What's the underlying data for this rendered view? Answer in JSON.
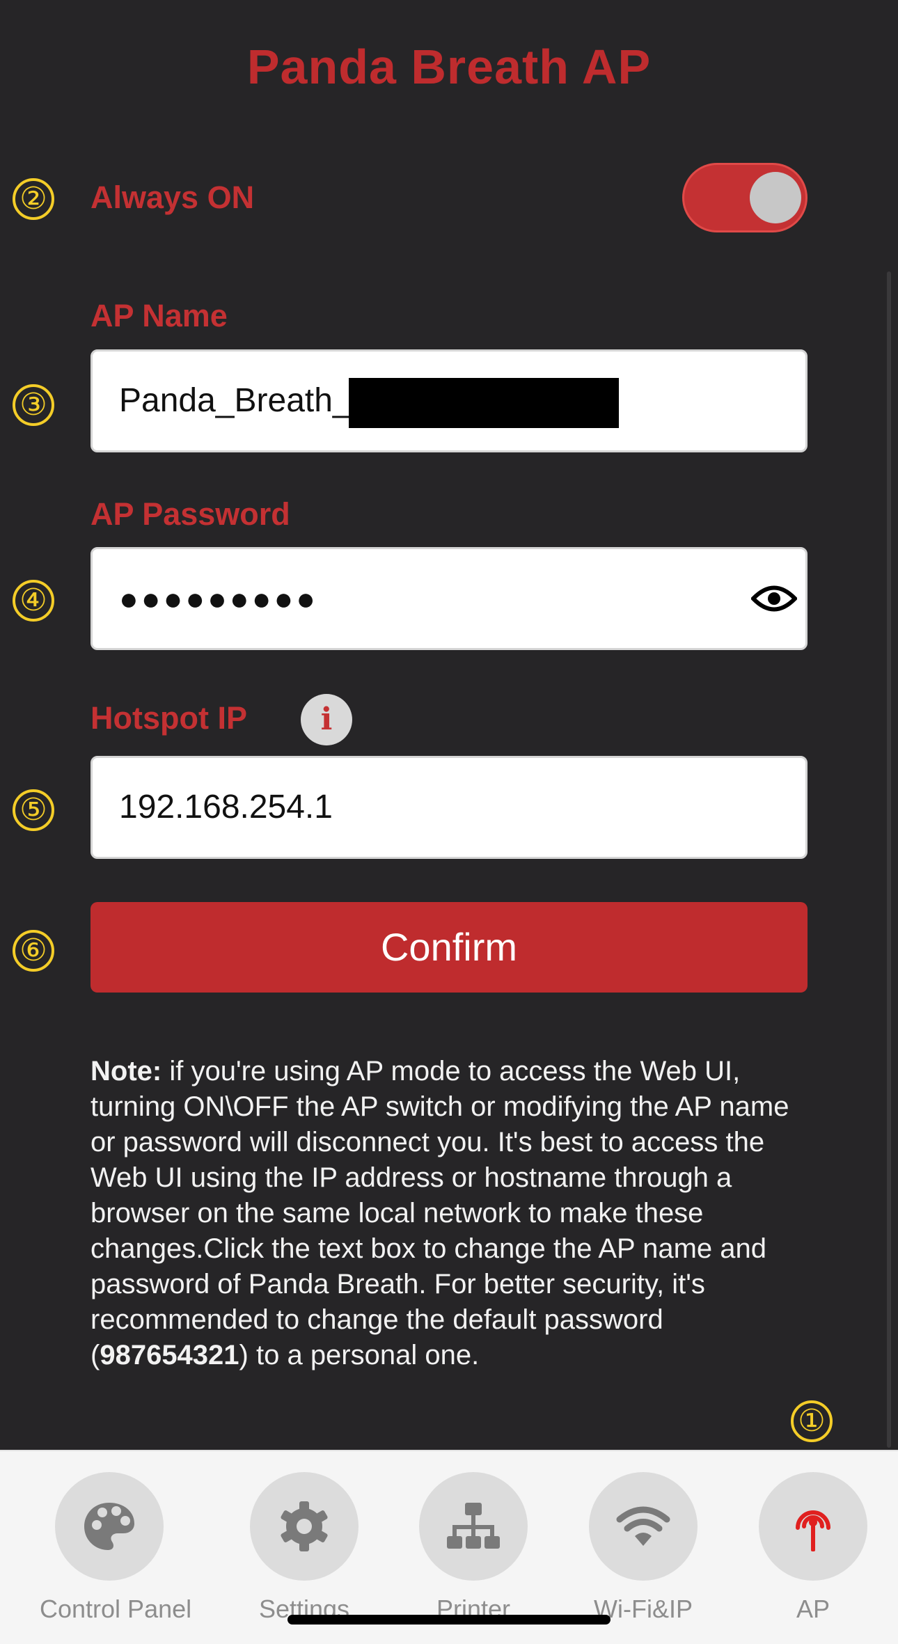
{
  "header": {
    "title": "Panda Breath AP"
  },
  "annotations": {
    "a1": "①",
    "a2": "②",
    "a3": "③",
    "a4": "④",
    "a5": "⑤",
    "a6": "⑥"
  },
  "always_on": {
    "label": "Always ON",
    "enabled": true
  },
  "ap_name": {
    "label": "AP Name",
    "value": "Panda_Breath_"
  },
  "ap_password": {
    "label": "AP Password",
    "value": "●●●●●●●●●"
  },
  "hotspot_ip": {
    "label": "Hotspot IP",
    "info": "i",
    "value": "192.168.254.1"
  },
  "confirm": {
    "label": "Confirm"
  },
  "note": {
    "prefix": "Note:",
    "text1": " if you're using AP mode to access the Web UI, turning ON\\OFF the AP switch or modifying the AP name or password will disconnect you. It's best to access the Web UI using the IP address or hostname through a browser on the same local network to make these changes.Click the text box to change the AP name and password of Panda Breath. For better security, it's recommended to change the default password (",
    "password": "987654321",
    "text2": ") to a personal one."
  },
  "tabs": [
    {
      "label": "Control Panel",
      "icon": "palette-icon",
      "active": false
    },
    {
      "label": "Settings",
      "icon": "gear-icon",
      "active": false
    },
    {
      "label": "Printer",
      "icon": "network-icon",
      "active": false
    },
    {
      "label": "Wi-Fi&IP",
      "icon": "wifi-icon",
      "active": false
    },
    {
      "label": "AP",
      "icon": "broadcast-icon",
      "active": true
    }
  ],
  "colors": {
    "accent": "#bf2c2e",
    "annotation": "#f4cd28",
    "background": "#262527"
  }
}
